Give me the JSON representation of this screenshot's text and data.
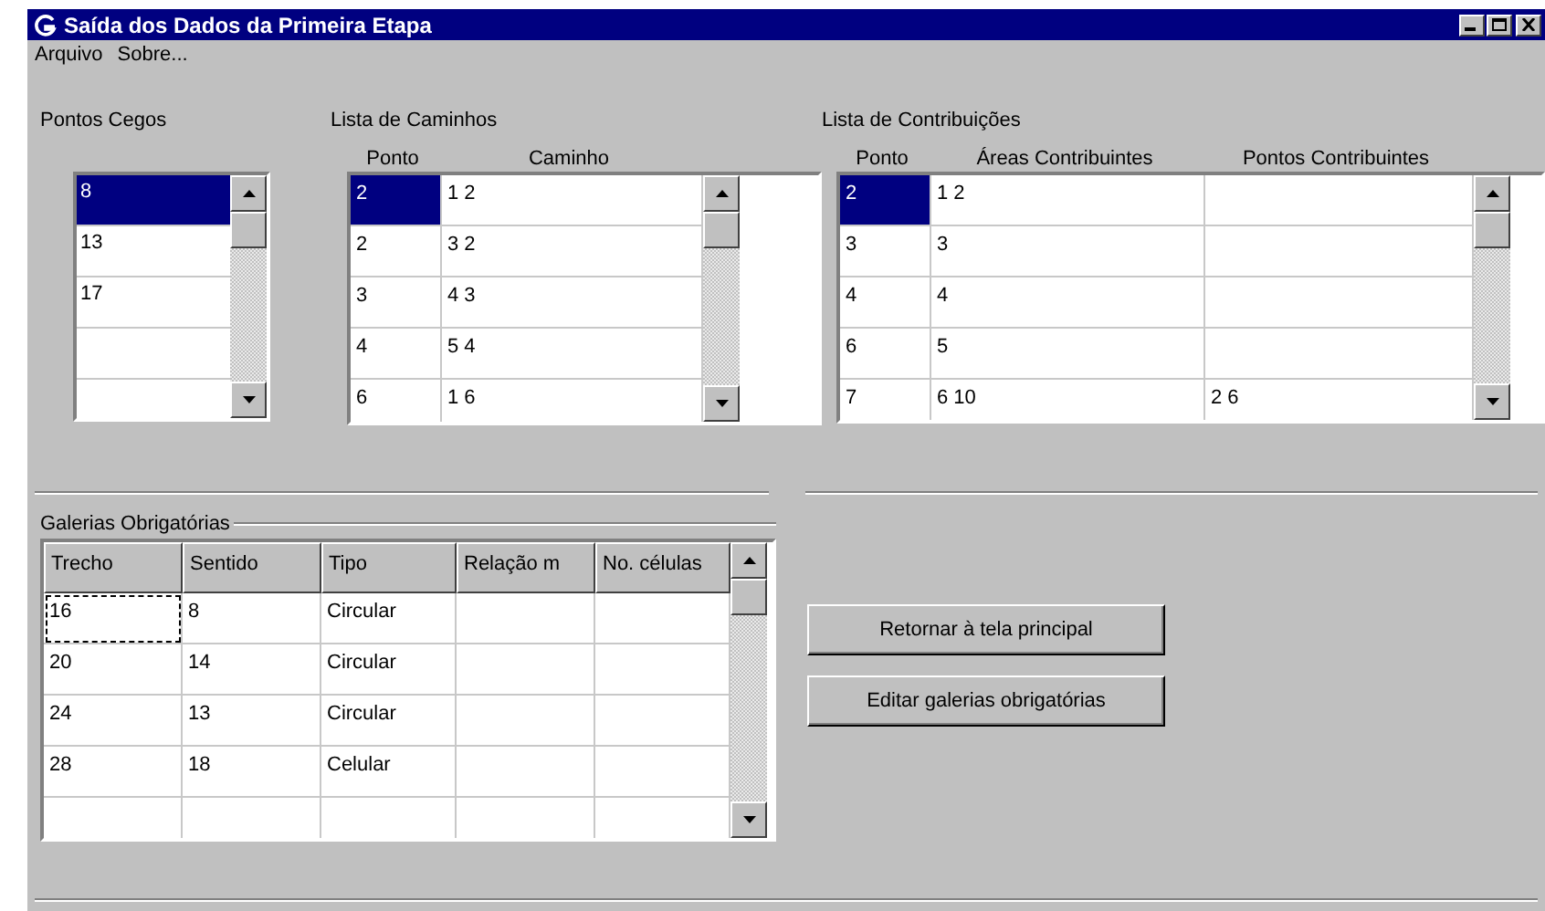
{
  "window": {
    "title": "Saída dos Dados da Primeira Etapa"
  },
  "menu": [
    "Arquivo",
    "Sobre..."
  ],
  "pontos_cegos": {
    "label": "Pontos Cegos",
    "items": [
      {
        "text": "8",
        "selected": true
      },
      {
        "text": "13",
        "selected": false
      },
      {
        "text": "17",
        "selected": false
      }
    ]
  },
  "lista_caminhos": {
    "label": "Lista de Caminhos",
    "columns": [
      "Ponto",
      "Caminho"
    ],
    "rows": [
      {
        "cells": [
          "2",
          "1 2"
        ],
        "selected": true
      },
      {
        "cells": [
          "2",
          "3 2"
        ],
        "selected": false
      },
      {
        "cells": [
          "3",
          "4 3"
        ],
        "selected": false
      },
      {
        "cells": [
          "4",
          "5 4"
        ],
        "selected": false
      },
      {
        "cells": [
          "6",
          "1 6"
        ],
        "selected": false
      }
    ]
  },
  "lista_contribuicoes": {
    "label": "Lista de Contribuições",
    "columns": [
      "Ponto",
      "Áreas Contribuintes",
      "Pontos Contribuintes"
    ],
    "rows": [
      {
        "cells": [
          "2",
          "1 2"
        ],
        "selected": true
      },
      {
        "cells": [
          "3",
          "3"
        ],
        "selected": false
      },
      {
        "cells": [
          "4",
          "4"
        ],
        "selected": false
      },
      {
        "cells": [
          "6",
          "5"
        ],
        "selected": false
      },
      {
        "cells": [
          "7",
          "6 10",
          "2 6"
        ],
        "selected": false
      }
    ]
  },
  "galerias": {
    "label": "Galerias Obrigatórias",
    "columns": [
      "Trecho",
      "Sentido",
      "Tipo",
      "Relação m",
      "No. células"
    ],
    "rows": [
      {
        "cells": [
          "16",
          "8",
          "Circular"
        ],
        "focused": true
      },
      {
        "cells": [
          "20",
          "14",
          "Circular"
        ],
        "focused": false
      },
      {
        "cells": [
          "24",
          "13",
          "Circular"
        ],
        "focused": false
      },
      {
        "cells": [
          "28",
          "18",
          "Celular"
        ],
        "focused": false
      }
    ]
  },
  "buttons": [
    "Retornar à tela principal",
    "Editar galerias obrigatórias"
  ]
}
